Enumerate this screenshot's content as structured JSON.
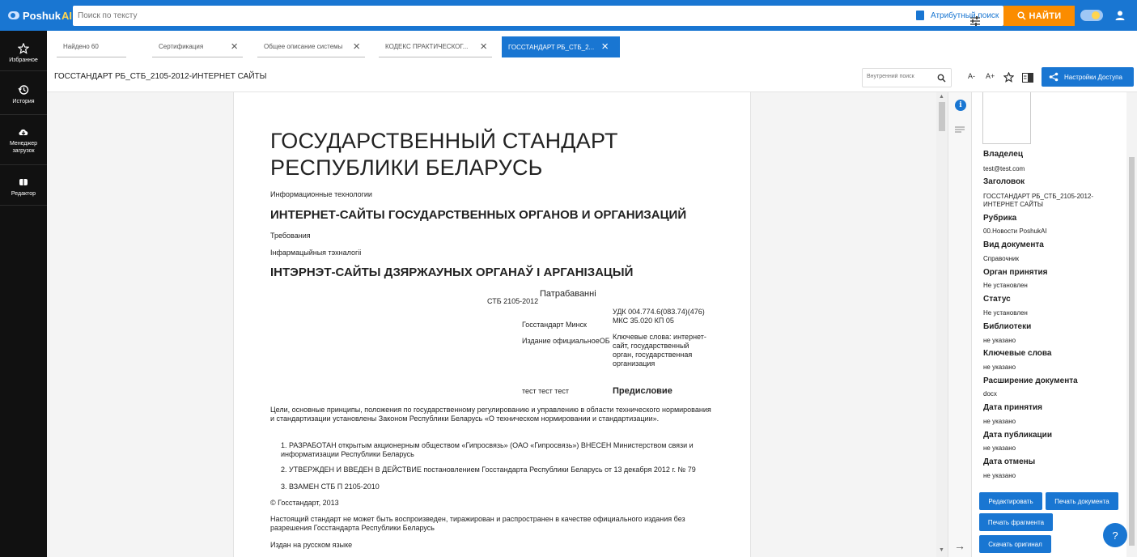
{
  "topbar": {
    "logo_main": "Poshuk",
    "logo_ai": "AI",
    "search_placeholder": "Поиск по тексту",
    "attr_search_label": "Атрибутный поиск",
    "find_button": "НАЙТИ",
    "accent": "#1976d2",
    "find_color": "#fb8c00"
  },
  "sidebar": {
    "items": [
      {
        "label": "Избранное",
        "icon": "star-icon"
      },
      {
        "label": "История",
        "icon": "history-icon"
      },
      {
        "label": "Менеджер загрузок",
        "icon": "cloud-download-icon"
      },
      {
        "label": "Редактор",
        "icon": "editor-icon"
      }
    ]
  },
  "tabs": [
    {
      "label": "Найдено 60",
      "closable": false
    },
    {
      "label": "Сертификация",
      "closable": true
    },
    {
      "label": "Общее описание системы",
      "closable": true
    },
    {
      "label": "КОДЕКС ПРАКТИЧЕСКОГ...",
      "closable": true
    },
    {
      "label": "ГОССТАНДАРТ РБ_СТБ_2...",
      "closable": true,
      "active": true
    }
  ],
  "doc_header": {
    "title": "ГОССТАНДАРТ РБ_СТБ_2105-2012-ИНТЕРНЕТ САЙТЫ",
    "inner_search_placeholder": "Внутренний поиск",
    "font_decrease": "A-",
    "font_increase": "A+",
    "access_button": "Настройки Доступа"
  },
  "document": {
    "title_line1": "ГОСУДАРСТВЕННЫЙ СТАНДАРТ",
    "title_line2": "РЕСПУБЛИКИ БЕЛАРУСЬ",
    "subtitle1": "Информационные технологии",
    "heading1": "ИНТЕРНЕТ-САЙТЫ ГОСУДАРСТВЕННЫХ ОРГАНОВ И ОРГАНИЗАЦИЙ",
    "req": "Требования",
    "subtitle2": "Інфармацыйныя тэхналогіі",
    "heading2": "ІНТЭРНЭТ-САЙТЫ ДЗЯРЖАУНЫХ ОРГАНАЎ І АРГАНІЗАЦЫЙ",
    "patr": "Патрабаванні",
    "stb": "СТБ 2105-2012",
    "udk": "УДК 004.774.6(083.74)(476)",
    "mks": "МКС 35.020 КП 05",
    "gosstandart_minsk": "Госстандарт Минск",
    "edition": "Издание официальноеОБ",
    "keywords": "Ключевые слова: интернет-сайт, государственный орган, государственная организация",
    "test": "тест тест тест",
    "foreword": "Предисловие",
    "goals": "Цели, основные принципы, положения по государственному регулированию и управлению в области технического нормирования и стандартизации установлены Законом Республики Беларусь «О техническом нормировании и стандартизации».",
    "list": [
      "1. РАЗРАБОТАН открытым акционерным обществом «Гипросвязь» (ОАО «Гипросвязь») ВНЕСЕН Министерством связи и информатизации Республики Беларусь",
      "2. УТВЕРЖДЕН И ВВЕДЕН В ДЕЙСТВИЕ постановлением Госстандарта Республики Беларусь от 13 декабря 2012 г. № 79",
      "3. ВЗАМЕН СТБ П 2105-2010"
    ],
    "copyright": "© Госстандарт, 2013",
    "notice": "Настоящий стандарт не может быть воспроизведен, тиражирован и распространен в качестве официального издания без разрешения Госстандарта Республики Беларусь",
    "lang": "Издан на русском языке"
  },
  "meta": {
    "fields": [
      {
        "label": "Владелец",
        "value": "test@test.com"
      },
      {
        "label": "Заголовок",
        "value": "ГОССТАНДАРТ РБ_СТБ_2105-2012-ИНТЕРНЕТ САЙТЫ"
      },
      {
        "label": "Рубрика",
        "value": "00.Новости PoshukAI"
      },
      {
        "label": "Вид документа",
        "value": "Справочник"
      },
      {
        "label": "Орган принятия",
        "value": "Не установлен"
      },
      {
        "label": "Статус",
        "value": "Не установлен"
      },
      {
        "label": "Библиотеки",
        "value": "не указано"
      },
      {
        "label": "Ключевые слова",
        "value": "не указано"
      },
      {
        "label": "Расширение документа",
        "value": "docx"
      },
      {
        "label": "Дата принятия",
        "value": "не указано"
      },
      {
        "label": "Дата публикации",
        "value": "не указано"
      },
      {
        "label": "Дата отмены",
        "value": "не указано"
      }
    ],
    "buttons": {
      "edit": "Редактировать",
      "print_doc": "Печать документа",
      "print_fragment": "Печать фрагмента",
      "download": "Скачать оригинал"
    },
    "help": "?"
  }
}
